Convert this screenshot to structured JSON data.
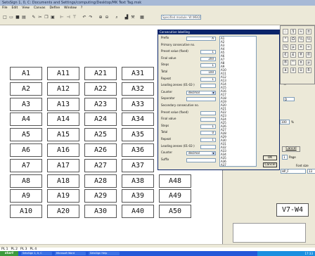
{
  "window": {
    "title": "SetsSign 1, 0, C: Documents and Settings/computing/Desktop/MK Text Tag.msk"
  },
  "menu": [
    "File",
    "Edit",
    "View",
    "Canvas",
    "Define",
    "Window",
    "?"
  ],
  "toolbar": {
    "file_field": "Specified module: W:\\MBQ\\MEAS"
  },
  "cells": [
    [
      "A1",
      "A2",
      "A3",
      "A4",
      "A5",
      "A6",
      "A7",
      "A8",
      "A9",
      "A10"
    ],
    [
      "A11",
      "A12",
      "A13",
      "A14",
      "A15",
      "A16",
      "A17",
      "A18",
      "A19",
      "A20"
    ],
    [
      "A21",
      "A22",
      "A23",
      "A24",
      "A25",
      "A26",
      "A27",
      "A28",
      "A29",
      "A30"
    ],
    [
      "A31",
      "A32",
      "A33",
      "A34",
      "A35",
      "A36",
      "A37",
      "A38",
      "A39",
      "A40"
    ],
    [
      "A48",
      "A49",
      "A50"
    ]
  ],
  "extra_cell": "V7-W4",
  "dialog": {
    "title": "Consecutive labelling",
    "fields": [
      {
        "label": "Prefix",
        "value": "A"
      },
      {
        "label": "Primary consecutive no.",
        "value": ""
      },
      {
        "label": "Preset value (fixed)",
        "value": "1"
      },
      {
        "label": "Final value",
        "value": "200"
      },
      {
        "label": "Steps",
        "value": "1"
      },
      {
        "label": "Total",
        "value": "100"
      },
      {
        "label": "Repeat",
        "value": "1"
      },
      {
        "label": "Leading zeroes (01-02-)",
        "value": ""
      },
      {
        "label": "Counter",
        "value": "decimal"
      },
      {
        "label": "Separator",
        "value": ""
      },
      {
        "label": "Secondary consecutive no.",
        "value": ""
      },
      {
        "label": "Preset value (fixed)",
        "value": ""
      },
      {
        "label": "Final value",
        "value": ""
      },
      {
        "label": "Steps",
        "value": "1"
      },
      {
        "label": "Total",
        "value": "0"
      },
      {
        "label": "Repeat",
        "value": "1"
      },
      {
        "label": "Leading zeroes (01-02-)",
        "value": ""
      },
      {
        "label": "Counter",
        "value": "decimal"
      },
      {
        "label": "Suffix",
        "value": ""
      }
    ],
    "list": [
      "A1",
      "A2",
      "A3",
      "A4",
      "A5",
      "A6",
      "A7",
      "A8",
      "A9",
      "A10",
      "A11",
      "A12",
      "A13",
      "A14",
      "A15",
      "A16",
      "A17",
      "A18",
      "A19",
      "A20",
      "A21",
      "A22",
      "A23",
      "A24",
      "A25",
      "A26",
      "A27",
      "A28",
      "A29",
      "A30",
      "A31",
      "A32",
      "A33",
      "A34",
      "A35",
      "A36",
      "A37"
    ],
    "ok_label": "OK",
    "cancel_label": "Cancel"
  },
  "symbols": [
    "∴",
    "§",
    "≈",
    "±",
    "°",
    "Ω",
    "¼",
    "½",
    "¾",
    "μ",
    "×",
    "÷",
    "€",
    "£",
    "¥",
    "©",
    "®",
    "™",
    "¤",
    "µ",
    "ä",
    "ö",
    "ü",
    "ß"
  ],
  "right_panel": {
    "title": "ext-edit",
    "cancel_label": "Cancel",
    "page_label": "Page",
    "font_label": "Font size",
    "font_value": "HP_F",
    "size_value": "100",
    "size_unit": "%",
    "num_value": "1",
    "cbx_value": "13"
  },
  "pages": [
    "PL 1",
    "PL 2",
    "PL 3",
    "PL 4"
  ],
  "taskbar": {
    "start": "start",
    "tasks": [
      "SetsSign 1, 0, C",
      "Microsoft Word",
      "SetsSign Help"
    ],
    "clock": "17:33"
  },
  "colors": {
    "title_bar": "#0a246a",
    "panel_bg": "#ece9d8",
    "taskbar": "#2458d8"
  }
}
